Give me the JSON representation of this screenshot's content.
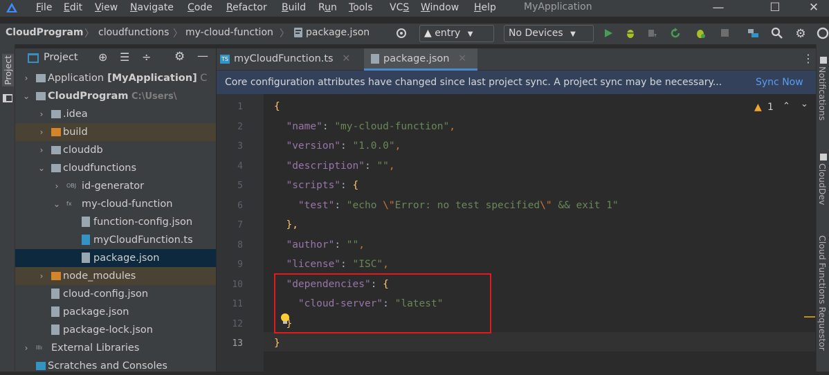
{
  "window": {
    "app_title": "MyApplication",
    "menu": [
      {
        "label": "File",
        "accel": "F",
        "rest": "ile"
      },
      {
        "label": "Edit",
        "accel": "E",
        "rest": "dit"
      },
      {
        "label": "View",
        "accel": "V",
        "rest": "iew"
      },
      {
        "label": "Navigate",
        "accel": "N",
        "rest": "avigate"
      },
      {
        "label": "Code",
        "accel": "C",
        "rest": "ode"
      },
      {
        "label": "Refactor",
        "accel": "R",
        "rest": "efactor"
      },
      {
        "label": "Build",
        "accel": "B",
        "rest": "uild"
      },
      {
        "label": "Run",
        "pre": "R",
        "accel": "u",
        "rest": "n"
      },
      {
        "label": "Tools",
        "accel": "T",
        "rest": "ools"
      },
      {
        "label": "VCS",
        "pre": "VC",
        "accel": "S",
        "rest": ""
      },
      {
        "label": "Window",
        "accel": "W",
        "rest": "indow"
      },
      {
        "label": "Help",
        "accel": "H",
        "rest": "elp"
      }
    ],
    "controls": {
      "minimize": "—",
      "maximize": "☐",
      "close": "✕"
    }
  },
  "breadcrumb": {
    "items": [
      "CloudProgram",
      "cloudfunctions",
      "my-cloud-function",
      "package.json"
    ],
    "separator": "〉"
  },
  "toolbar": {
    "run_config": "entry",
    "devices": "No Devices",
    "colors": {
      "run": "#499c54",
      "debug": "#a8c023",
      "disabled": "#6e6e6e"
    }
  },
  "project_panel": {
    "strip_label": "Project",
    "title": "Project",
    "tree": [
      {
        "label": "Application",
        "bold_suffix": "[MyApplication]",
        "trail": "C",
        "icon": "module-icon",
        "indent": 0,
        "arrow": "›"
      },
      {
        "label": "CloudProgram",
        "dim_suffix": "C:\\Users\\",
        "icon": "module-icon",
        "indent": 0,
        "arrow": "⌄",
        "bold": true
      },
      {
        "label": ".idea",
        "icon": "folder-icon",
        "indent": 1,
        "arrow": "›"
      },
      {
        "label": "build",
        "icon": "orange-folder-icon",
        "indent": 1,
        "arrow": "›"
      },
      {
        "label": "clouddb",
        "icon": "folder-icon",
        "indent": 1,
        "arrow": "›"
      },
      {
        "label": "cloudfunctions",
        "icon": "cloud-folder-icon",
        "indent": 1,
        "arrow": "⌄"
      },
      {
        "label": "id-generator",
        "icon": "obj-icon",
        "indent": 2,
        "arrow": "›"
      },
      {
        "label": "my-cloud-function",
        "icon": "fx-icon",
        "indent": 2,
        "arrow": "⌄"
      },
      {
        "label": "function-config.json",
        "icon": "json-file-icon",
        "indent": 3
      },
      {
        "label": "myCloudFunction.ts",
        "icon": "ts-file-icon",
        "indent": 3
      },
      {
        "label": "package.json",
        "icon": "json-file-icon",
        "indent": 3,
        "selected": true
      },
      {
        "label": "node_modules",
        "icon": "orange-folder-icon",
        "indent": 1,
        "arrow": "›"
      },
      {
        "label": "cloud-config.json",
        "icon": "json-file-icon",
        "indent": 1
      },
      {
        "label": "package.json",
        "icon": "json-file-icon",
        "indent": 1
      },
      {
        "label": "package-lock.json",
        "icon": "json-file-icon",
        "indent": 1
      },
      {
        "label": "External Libraries",
        "icon": "library-icon",
        "indent": 0,
        "arrow": "›"
      },
      {
        "label": "Scratches and Consoles",
        "icon": "scratches-icon",
        "indent": 0
      }
    ]
  },
  "editor": {
    "tabs": [
      {
        "label": "myCloudFunction.ts",
        "active": false
      },
      {
        "label": "package.json",
        "active": true
      }
    ],
    "banner": {
      "text": "Core configuration attributes have changed since last project sync. A project sync may be necessary...",
      "link": "Sync Now"
    },
    "inspection": {
      "count": "1"
    },
    "line_numbers": [
      "1",
      "2",
      "3",
      "4",
      "5",
      "6",
      "7",
      "8",
      "9",
      "10",
      "11",
      "12",
      "13"
    ],
    "lines": [
      "{",
      "  \"name\": \"my-cloud-function\",",
      "  \"version\": \"1.0.0\",",
      "  \"description\": \"\",",
      "  \"scripts\": {",
      "    \"test\": \"echo \\\"Error: no test specified\\\" && exit 1\"",
      "  },",
      "  \"author\": \"\",",
      "  \"license\": \"ISC\",",
      "  \"dependencies\": {",
      "    \"cloud-server\": \"latest\"",
      "  }",
      "}"
    ]
  },
  "right_strip": {
    "labels": [
      "Notifications",
      "CloudDev",
      "Cloud Functions Requestor"
    ]
  }
}
